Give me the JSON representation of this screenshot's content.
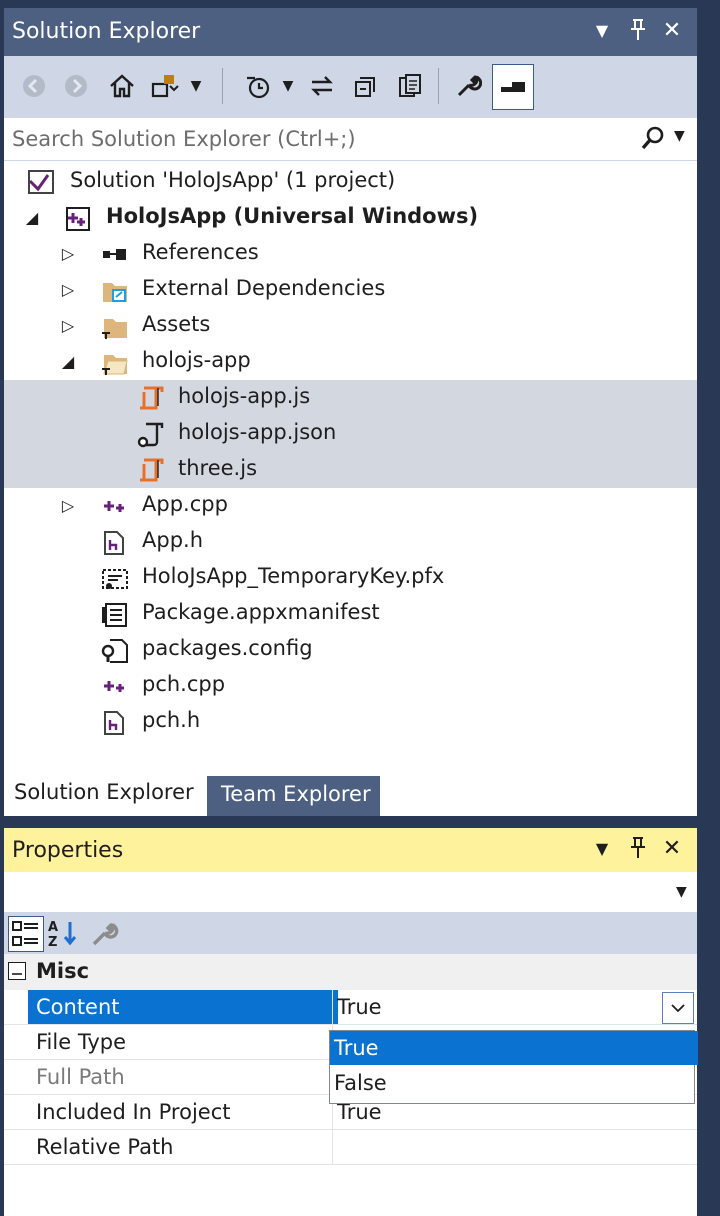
{
  "solution_explorer": {
    "title": "Solution Explorer",
    "search_placeholder": "Search Solution Explorer (Ctrl+;)",
    "tree": {
      "solution": "Solution 'HoloJsApp' (1 project)",
      "project": "HoloJsApp (Universal Windows)",
      "items": [
        "References",
        "External Dependencies",
        "Assets",
        "holojs-app",
        "holojs-app.js",
        "holojs-app.json",
        "three.js",
        "App.cpp",
        "App.h",
        "HoloJsApp_TemporaryKey.pfx",
        "Package.appxmanifest",
        "packages.config",
        "pch.cpp",
        "pch.h"
      ]
    },
    "tabs": [
      "Solution Explorer",
      "Team Explorer"
    ]
  },
  "properties": {
    "title": "Properties",
    "category": "Misc",
    "rows": [
      {
        "name": "Content",
        "value": "True"
      },
      {
        "name": "File Type",
        "value": ""
      },
      {
        "name": "Full Path",
        "value": ""
      },
      {
        "name": "Included In Project",
        "value": "True"
      },
      {
        "name": "Relative Path",
        "value": ""
      }
    ],
    "dropdown_options": [
      "True",
      "False"
    ]
  },
  "colors": {
    "title_bar": "#4d6082",
    "toolbar": "#cfd6e5",
    "selection": "#0a73d1",
    "properties_title": "#fff29d"
  }
}
